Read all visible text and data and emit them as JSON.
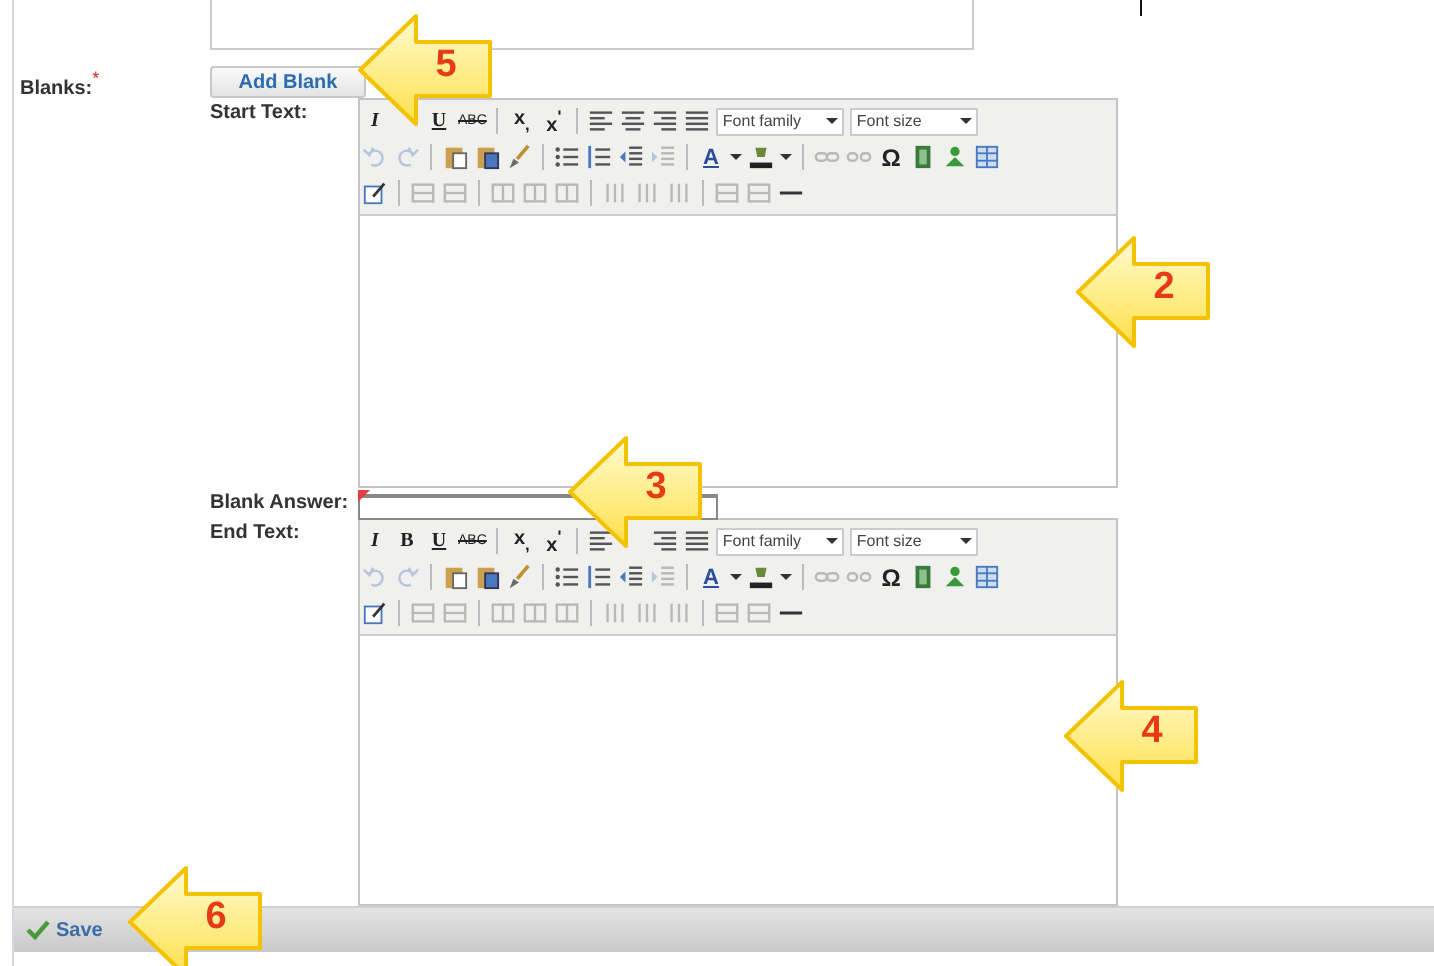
{
  "form": {
    "blanks_label": "Blanks:",
    "required_mark": "*",
    "add_blank_button": "Add Blank",
    "start_text": {
      "label": "Start Text:",
      "toolbar": [
        [
          {
            "kind": "italic",
            "label": "I"
          },
          {
            "kind": "covered"
          },
          {
            "kind": "underline",
            "label": "U"
          },
          {
            "kind": "strike",
            "label": "ABC"
          },
          {
            "kind": "separator"
          },
          {
            "kind": "sub",
            "label": "x$_{,}$"
          },
          {
            "kind": "sup",
            "label": "x$^{'}$"
          },
          {
            "kind": "separator"
          },
          {
            "kind": "align-left",
            "disabled": false
          },
          {
            "kind": "align-center",
            "disabled": false
          },
          {
            "kind": "align-right",
            "disabled": false
          },
          {
            "kind": "justify",
            "disabled": false
          },
          {
            "kind": "select",
            "label": "Font family"
          },
          {
            "kind": "select",
            "label": "Font size"
          }
        ],
        [
          {
            "kind": "undo",
            "disabled": true
          },
          {
            "kind": "redo",
            "disabled": true
          },
          {
            "kind": "separator"
          },
          {
            "kind": "paste",
            "disabled": false
          },
          {
            "kind": "paste-word",
            "disabled": false
          },
          {
            "kind": "cleanup",
            "disabled": false
          },
          {
            "kind": "separator"
          },
          {
            "kind": "bullets",
            "disabled": false
          },
          {
            "kind": "numbering",
            "disabled": false
          },
          {
            "kind": "outdent",
            "disabled": false
          },
          {
            "kind": "indent",
            "disabled": true
          },
          {
            "kind": "separator"
          },
          {
            "kind": "forecolor",
            "label": "A"
          },
          {
            "kind": "backcolor",
            "disabled": false
          },
          {
            "kind": "separator"
          },
          {
            "kind": "link",
            "disabled": true
          },
          {
            "kind": "unlink",
            "disabled": true
          },
          {
            "kind": "omega",
            "label": "Ω"
          },
          {
            "kind": "film",
            "disabled": false
          },
          {
            "kind": "image",
            "disabled": false
          },
          {
            "kind": "table",
            "disabled": false
          }
        ],
        [
          {
            "kind": "edit",
            "disabled": false
          },
          {
            "kind": "separator"
          },
          {
            "kind": "row",
            "disabled": true
          },
          {
            "kind": "row",
            "disabled": true
          },
          {
            "kind": "separator"
          },
          {
            "kind": "cell",
            "disabled": true
          },
          {
            "kind": "cell",
            "disabled": true
          },
          {
            "kind": "cell",
            "disabled": true
          },
          {
            "kind": "separator"
          },
          {
            "kind": "column",
            "disabled": true
          },
          {
            "kind": "column",
            "disabled": true
          },
          {
            "kind": "column",
            "disabled": true
          },
          {
            "kind": "separator"
          },
          {
            "kind": "row",
            "disabled": true
          },
          {
            "kind": "row",
            "disabled": true
          },
          {
            "kind": "rule",
            "disabled": false
          }
        ]
      ]
    },
    "blank_answer": {
      "label": "Blank Answer:",
      "required": true
    },
    "end_text": {
      "label": "End Text:",
      "toolbar": [
        [
          {
            "kind": "italic",
            "label": "I"
          },
          {
            "kind": "bold",
            "label": "B"
          },
          {
            "kind": "underline",
            "label": "U"
          },
          {
            "kind": "strike",
            "label": "ABC"
          },
          {
            "kind": "separator"
          },
          {
            "kind": "sub",
            "label": "x$_{,}$"
          },
          {
            "kind": "sup",
            "label": "x$^{'}$"
          },
          {
            "kind": "separator"
          },
          {
            "kind": "align-left",
            "disabled": false
          },
          {
            "kind": "covered"
          },
          {
            "kind": "align-right",
            "disabled": false
          },
          {
            "kind": "justify",
            "disabled": false
          },
          {
            "kind": "select",
            "label": "Font family"
          },
          {
            "kind": "select",
            "label": "Font size"
          }
        ],
        [
          {
            "kind": "undo",
            "disabled": true
          },
          {
            "kind": "redo",
            "disabled": true
          },
          {
            "kind": "separator"
          },
          {
            "kind": "paste",
            "disabled": false
          },
          {
            "kind": "paste-word",
            "disabled": false
          },
          {
            "kind": "cleanup",
            "disabled": false
          },
          {
            "kind": "separator"
          },
          {
            "kind": "bullets",
            "disabled": false
          },
          {
            "kind": "numbering",
            "disabled": false
          },
          {
            "kind": "outdent",
            "disabled": false
          },
          {
            "kind": "indent",
            "disabled": true
          },
          {
            "kind": "separator"
          },
          {
            "kind": "forecolor",
            "label": "A"
          },
          {
            "kind": "backcolor",
            "disabled": false
          },
          {
            "kind": "separator"
          },
          {
            "kind": "link",
            "disabled": true
          },
          {
            "kind": "unlink",
            "disabled": true
          },
          {
            "kind": "omega",
            "label": "Ω"
          },
          {
            "kind": "film",
            "disabled": false
          },
          {
            "kind": "image",
            "disabled": false
          },
          {
            "kind": "table",
            "disabled": false
          }
        ],
        [
          {
            "kind": "edit",
            "disabled": false
          },
          {
            "kind": "separator"
          },
          {
            "kind": "row",
            "disabled": true
          },
          {
            "kind": "row",
            "disabled": true
          },
          {
            "kind": "separator"
          },
          {
            "kind": "cell",
            "disabled": true
          },
          {
            "kind": "cell",
            "disabled": true
          },
          {
            "kind": "cell",
            "disabled": true
          },
          {
            "kind": "separator"
          },
          {
            "kind": "column",
            "disabled": true
          },
          {
            "kind": "column",
            "disabled": true
          },
          {
            "kind": "column",
            "disabled": true
          },
          {
            "kind": "separator"
          },
          {
            "kind": "row",
            "disabled": true
          },
          {
            "kind": "row",
            "disabled": true
          },
          {
            "kind": "rule",
            "disabled": false
          }
        ]
      ]
    }
  },
  "footer": {
    "save_button": "Save"
  },
  "callouts": [
    {
      "number": "5"
    },
    {
      "number": "2"
    },
    {
      "number": "3"
    },
    {
      "number": "4"
    },
    {
      "number": "6"
    }
  ]
}
